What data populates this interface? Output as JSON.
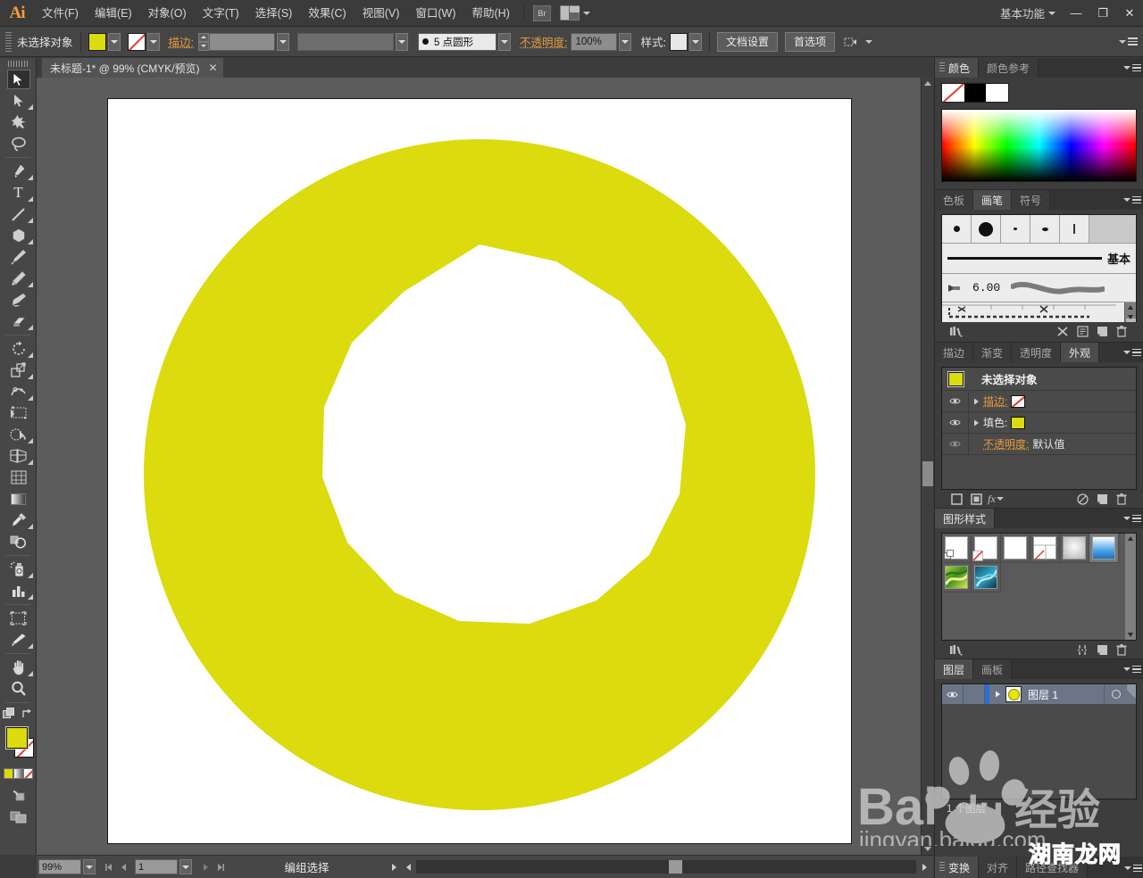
{
  "app": {
    "name": "Adobe Illustrator",
    "logo": "Ai",
    "workspace": "基本功能"
  },
  "menubar": {
    "items": [
      "文件(F)",
      "编辑(E)",
      "对象(O)",
      "文字(T)",
      "选择(S)",
      "效果(C)",
      "视图(V)",
      "窗口(W)",
      "帮助(H)"
    ],
    "bridge_label": "Br",
    "window_controls": {
      "minimize": "—",
      "restore": "❐",
      "close": "✕"
    }
  },
  "controlbar": {
    "selection_label": "未选择对象",
    "fill_color": "#dbdb0e",
    "stroke_label": "描边:",
    "stroke_weight": "",
    "stroke_profile": "",
    "brush_def": "5 点圆形",
    "opacity_label": "不透明度:",
    "opacity_value": "100%",
    "style_label": "样式:",
    "doc_setup_button": "文档设置",
    "preferences_button": "首选项"
  },
  "document_tab": {
    "title": "未标题-1* @ 99% (CMYK/预览)",
    "close": "✕"
  },
  "toolbar": {
    "tools": [
      {
        "name": "selection-tool",
        "glyph": "arrow-solid",
        "selected": true,
        "hasflyout": false
      },
      {
        "name": "direct-selection-tool",
        "glyph": "arrow-hollow",
        "selected": false,
        "hasflyout": true
      },
      {
        "name": "magic-wand-tool",
        "glyph": "magic-wand",
        "selected": false,
        "hasflyout": false
      },
      {
        "name": "lasso-tool",
        "glyph": "lasso",
        "selected": false,
        "hasflyout": false
      },
      {
        "name": "pen-tool",
        "glyph": "pen",
        "selected": false,
        "hasflyout": true
      },
      {
        "name": "type-tool",
        "glyph": "type-T",
        "selected": false,
        "hasflyout": true
      },
      {
        "name": "line-segment-tool",
        "glyph": "line",
        "selected": false,
        "hasflyout": true
      },
      {
        "name": "polygon-tool",
        "glyph": "polygon",
        "selected": false,
        "hasflyout": true
      },
      {
        "name": "paintbrush-tool",
        "glyph": "brush",
        "selected": false,
        "hasflyout": false
      },
      {
        "name": "pencil-tool",
        "glyph": "pencil",
        "selected": false,
        "hasflyout": true
      },
      {
        "name": "blob-brush-tool",
        "glyph": "blob-brush",
        "selected": false,
        "hasflyout": false
      },
      {
        "name": "eraser-tool",
        "glyph": "eraser",
        "selected": false,
        "hasflyout": true
      },
      {
        "name": "rotate-tool",
        "glyph": "rotate",
        "selected": false,
        "hasflyout": true
      },
      {
        "name": "scale-tool",
        "glyph": "scale",
        "selected": false,
        "hasflyout": true
      },
      {
        "name": "width-tool",
        "glyph": "width",
        "selected": false,
        "hasflyout": true
      },
      {
        "name": "free-transform-tool",
        "glyph": "free-transform",
        "selected": false,
        "hasflyout": false
      },
      {
        "name": "shape-builder-tool",
        "glyph": "shape-builder",
        "selected": false,
        "hasflyout": true
      },
      {
        "name": "perspective-grid-tool",
        "glyph": "perspective-grid",
        "selected": false,
        "hasflyout": true
      },
      {
        "name": "mesh-tool",
        "glyph": "mesh",
        "selected": false,
        "hasflyout": false
      },
      {
        "name": "gradient-tool",
        "glyph": "gradient",
        "selected": false,
        "hasflyout": false
      },
      {
        "name": "eyedropper-tool",
        "glyph": "eyedropper",
        "selected": false,
        "hasflyout": true
      },
      {
        "name": "blend-tool",
        "glyph": "blend",
        "selected": false,
        "hasflyout": false
      },
      {
        "name": "symbol-sprayer-tool",
        "glyph": "symbol-sprayer",
        "selected": false,
        "hasflyout": true
      },
      {
        "name": "column-graph-tool",
        "glyph": "bar-graph",
        "selected": false,
        "hasflyout": true
      },
      {
        "name": "artboard-tool",
        "glyph": "artboard",
        "selected": false,
        "hasflyout": false
      },
      {
        "name": "slice-tool",
        "glyph": "slice",
        "selected": false,
        "hasflyout": true
      },
      {
        "name": "hand-tool",
        "glyph": "hand",
        "selected": false,
        "hasflyout": true
      },
      {
        "name": "zoom-tool",
        "glyph": "magnifier",
        "selected": false,
        "hasflyout": false
      }
    ],
    "fill_color": "#dbdb0e",
    "stroke_color": "none"
  },
  "canvas": {
    "artboard_bg": "#ffffff",
    "shape": {
      "type": "donut-polygon",
      "fill": "#dbdb0e",
      "inner_fill": "#ffffff",
      "outer_sides": 40,
      "inner_sides": 13
    }
  },
  "statusbar": {
    "zoom": "99%",
    "page": "1",
    "status_text": "编组选择"
  },
  "panels": {
    "color": {
      "tabs": [
        "颜色",
        "颜色参考"
      ],
      "active_tab": "颜色"
    },
    "brushes": {
      "tabs": [
        "色板",
        "画笔",
        "符号"
      ],
      "active_tab": "画笔",
      "basic_label": "基本",
      "size_value": "6.00"
    },
    "appearance": {
      "tabs": [
        "描边",
        "渐变",
        "透明度",
        "外观"
      ],
      "active_tab": "外观",
      "title": "未选择对象",
      "rows": [
        {
          "label": "描边:",
          "orange": true,
          "swatch": "none"
        },
        {
          "label": "填色:",
          "orange": false,
          "swatch": "yellow"
        },
        {
          "label": "不透明度:",
          "orange": true,
          "value": "默认值"
        }
      ]
    },
    "graphic_styles": {
      "tabs": [
        "图形样式"
      ],
      "active_tab": "图形样式",
      "count": 8
    },
    "layers": {
      "tabs": [
        "图层",
        "画板"
      ],
      "active_tab": "图层",
      "layer_name": "图层 1",
      "footer": "1 个图层"
    },
    "bottom_tabs": [
      "变换",
      "对齐",
      "路径查找器"
    ]
  },
  "watermarks": {
    "baidu_main": "Bai",
    "baidu_du": "du",
    "baidu_cn": "经验",
    "baidu_url": "jingyan.baidu.com",
    "hunan_orange": "湖南",
    "hunan_black": "龙网"
  }
}
